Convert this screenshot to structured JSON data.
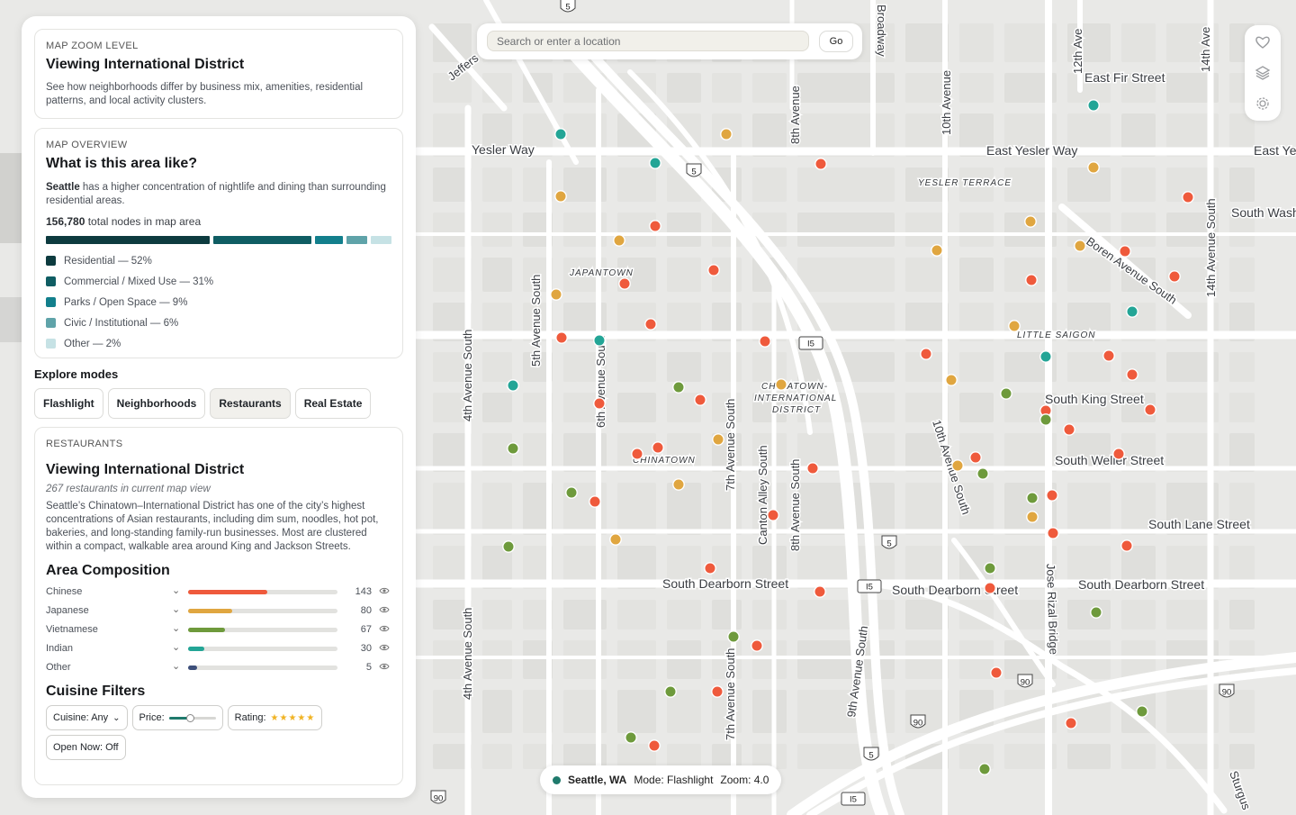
{
  "search": {
    "placeholder": "Search or enter a location",
    "go_label": "Go"
  },
  "zoom_card": {
    "eyebrow": "MAP ZOOM LEVEL",
    "title": "Viewing International District",
    "description": "See how neighborhoods differ by business mix, amenities, residential patterns, and local activity clusters."
  },
  "overview": {
    "eyebrow": "MAP OVERVIEW",
    "title": "What is this area like?",
    "city": "Seattle",
    "summary_rest": " has a higher concentration of nightlife and dining than surrounding residential areas.",
    "total_nodes": "156,780",
    "total_suffix": " total nodes in map area",
    "segments": [
      {
        "label": "Residential — 52%",
        "share": 52,
        "color": "#0d3b3f"
      },
      {
        "label": "Commercial / Mixed Use — 31%",
        "share": 31,
        "color": "#0f5d63"
      },
      {
        "label": "Parks / Open Space — 9%",
        "share": 9,
        "color": "#127f8c"
      },
      {
        "label": "Civic / Institutional — 6%",
        "share": 6,
        "color": "#5fa3a9"
      },
      {
        "label": "Other — 2%",
        "share": 2,
        "color": "#c6e2e5"
      }
    ]
  },
  "explore": {
    "label": "Explore modes",
    "modes": [
      {
        "label": "Flashlight",
        "active": false
      },
      {
        "label": "Neighborhoods",
        "active": false
      },
      {
        "label": "Restaurants",
        "active": true
      },
      {
        "label": "Real Estate",
        "active": false
      }
    ]
  },
  "restaurants": {
    "eyebrow": "RESTAURANTS",
    "title": "Viewing International District",
    "count_line": "267 restaurants in current map view",
    "description": "Seattle’s Chinatown–International District has one of the city’s highest concentrations of Asian restaurants, including dim sum, noodles, hot pot, bakeries, and long-standing family-run businesses. Most are clustered within a compact, walkable area around King and Jackson Streets.",
    "composition_title": "Area Composition",
    "composition": [
      {
        "name": "Chinese",
        "count": 143,
        "color": "#ef5a3c"
      },
      {
        "name": "Japanese",
        "count": 80,
        "color": "#e0a640"
      },
      {
        "name": "Vietnamese",
        "count": 67,
        "color": "#6e9a3c"
      },
      {
        "name": "Indian",
        "count": 30,
        "color": "#23a596"
      },
      {
        "name": "Other",
        "count": 5,
        "color": "#3d4f7a"
      }
    ],
    "composition_max": 270,
    "filters_title": "Cuisine Filters",
    "filters": {
      "cuisine": "Cuisine: Any",
      "price": "Price:",
      "rating": "Rating:",
      "rating_stars": "★★★★★",
      "open_now": "Open Now: Off"
    }
  },
  "status": {
    "city": "Seattle, WA",
    "mode": "Mode: Flashlight",
    "zoom": "Zoom: 4.0"
  },
  "map": {
    "street_labels": [
      {
        "text": "Yesler Way"
      },
      {
        "text": "East Yesler Way"
      },
      {
        "text": "East Ye"
      },
      {
        "text": "East Fir Street"
      },
      {
        "text": "South Wash"
      },
      {
        "text": "South King Street"
      },
      {
        "text": "South Weller Street"
      },
      {
        "text": "South Lane Street"
      },
      {
        "text": "South Dearborn Street"
      },
      {
        "text": "South Dearborn Street"
      },
      {
        "text": "South Dearborn Street"
      },
      {
        "text": "4th Avenue South"
      },
      {
        "text": "4th Avenue South"
      },
      {
        "text": "5th Avenue South"
      },
      {
        "text": "6th Avenue South"
      },
      {
        "text": "7th Avenue South"
      },
      {
        "text": "7th Avenue South"
      },
      {
        "text": "Canton Alley South"
      },
      {
        "text": "8th Avenue South"
      },
      {
        "text": "8th Avenue"
      },
      {
        "text": "10th Avenue"
      },
      {
        "text": "10th Avenue South"
      },
      {
        "text": "9th Avenue South"
      },
      {
        "text": "12th Ave"
      },
      {
        "text": "14th Ave"
      },
      {
        "text": "14th Avenue South"
      },
      {
        "text": "Broadway"
      },
      {
        "text": "Boren Avenue South"
      },
      {
        "text": "Jose Rizal Bridge"
      },
      {
        "text": "Jeffers"
      },
      {
        "text": "Sturgus"
      }
    ],
    "area_labels": [
      {
        "text": "YESLER TERRACE"
      },
      {
        "text": "JAPANTOWN"
      },
      {
        "text": "LITTLE SAIGON"
      },
      {
        "text": "CHINATOWN-"
      },
      {
        "text": "INTERNATIONAL"
      },
      {
        "text": "DISTRICT"
      },
      {
        "text": "CHINATOWN"
      }
    ],
    "shields": [
      {
        "text": "5"
      },
      {
        "text": "I5"
      },
      {
        "text": "90"
      }
    ],
    "legend_colors": {
      "chinese": "#ef5a3c",
      "japanese": "#e0a640",
      "vietnamese": "#6e9a3c",
      "indian": "#23a596"
    }
  }
}
